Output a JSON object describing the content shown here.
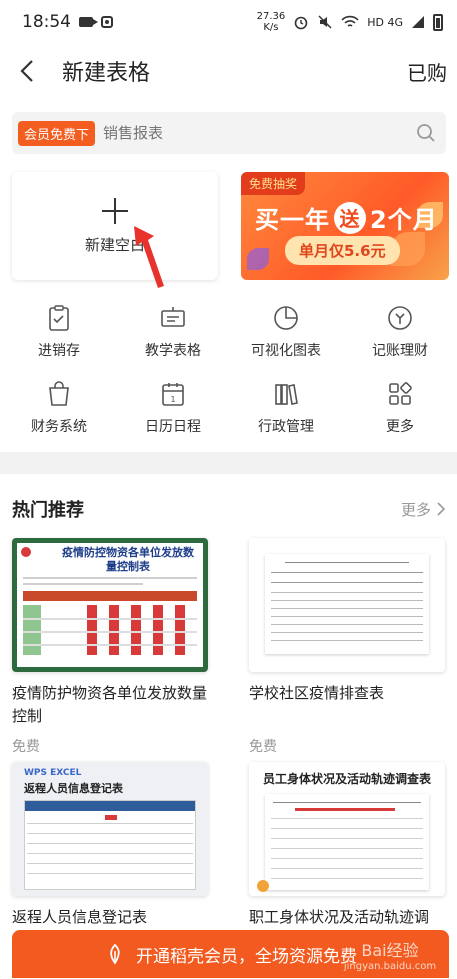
{
  "status_bar": {
    "time": "18:54",
    "speed_value": "27.36",
    "speed_unit": "K/s",
    "network": "HD 4G"
  },
  "nav": {
    "title": "新建表格",
    "purchased": "已购"
  },
  "search": {
    "badge": "会员免费下",
    "placeholder": "销售报表"
  },
  "new_blank": {
    "label": "新建空白"
  },
  "promo": {
    "tag": "免费抽奖",
    "headline_a": "买一年",
    "headline_song": "送",
    "headline_b": "2个月",
    "sub": "单月仅5.6元"
  },
  "categories": [
    {
      "label": "进销存",
      "icon": "clipboard-check-icon"
    },
    {
      "label": "教学表格",
      "icon": "easel-icon"
    },
    {
      "label": "可视化图表",
      "icon": "pie-chart-icon"
    },
    {
      "label": "记账理财",
      "icon": "coin-icon"
    },
    {
      "label": "财务系统",
      "icon": "shopping-bag-icon"
    },
    {
      "label": "日历日程",
      "icon": "calendar-icon"
    },
    {
      "label": "行政管理",
      "icon": "books-icon"
    },
    {
      "label": "更多",
      "icon": "grid-more-icon"
    }
  ],
  "recommend": {
    "title": "热门推荐",
    "more": "更多",
    "items": [
      {
        "title": "疫情防护物资各单位发放数量控制",
        "price": "免费",
        "thumb_heading": "疫情防控物资各单位发放数量控制表"
      },
      {
        "title": "学校社区疫情排查表",
        "price": "免费",
        "thumb_heading": ""
      },
      {
        "title": "返程人员信息登记表",
        "price": "",
        "thumb_brand": "WPS EXCEL",
        "thumb_heading": "返程人员信息登记表"
      },
      {
        "title": "职工身体状况及活动轨迹调",
        "price": "",
        "thumb_heading": "员工身体状况及活动轨迹调查表"
      }
    ]
  },
  "bottom_cta": {
    "label": "开通稻壳会员，全场资源免费"
  },
  "watermark": {
    "text": "Bai经验",
    "sub": "jingyan.baidu.com"
  },
  "colors": {
    "accent": "#f25a1f",
    "badge": "#f35d20",
    "divider": "#f2f2f2"
  }
}
